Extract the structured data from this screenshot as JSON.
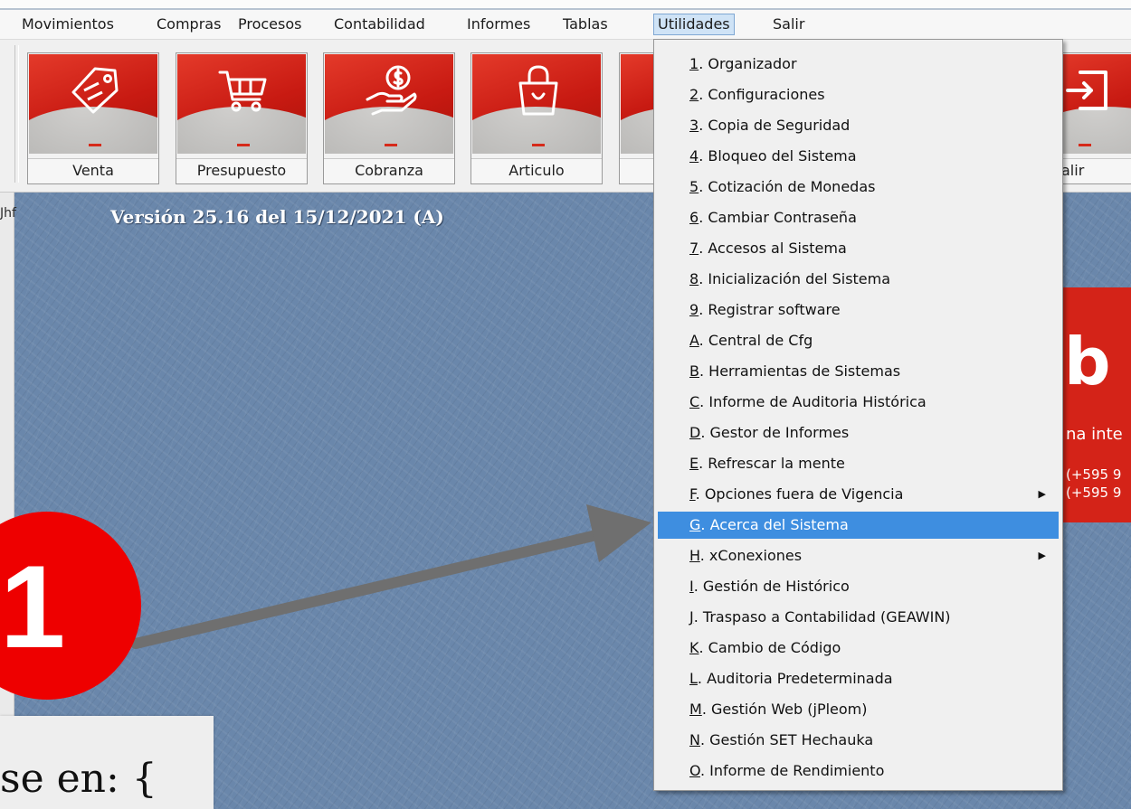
{
  "menubar": {
    "items": [
      "Movimientos",
      "Compras",
      "Procesos",
      "Contabilidad",
      "Informes",
      "Tablas",
      "Utilidades",
      "Salir"
    ],
    "active": "Utilidades"
  },
  "toolbar": {
    "buttons": [
      {
        "label": "Venta",
        "icon": "price-tag-icon"
      },
      {
        "label": "Presupuesto",
        "icon": "shopping-cart-icon"
      },
      {
        "label": "Cobranza",
        "icon": "coin-hand-icon"
      },
      {
        "label": "Articulo",
        "icon": "shopping-bag-icon"
      },
      {
        "label": "alir",
        "icon": "exit-door-icon"
      }
    ]
  },
  "desktop": {
    "user_tag": "Jhf",
    "version": "Versión 25.16 del 15/12/2021  (A)",
    "logo": {
      "mark": "b",
      "tagline": "na inte",
      "phone1": "(+595 9",
      "phone2": "(+595 9"
    }
  },
  "utilidades_menu": {
    "items": [
      {
        "key": "1",
        "text": ". Organizador"
      },
      {
        "key": "2",
        "text": ". Configuraciones"
      },
      {
        "key": "3",
        "text": ". Copia de Seguridad"
      },
      {
        "key": "4",
        "text": ". Bloqueo del Sistema"
      },
      {
        "key": "5",
        "text": ". Cotización de Monedas"
      },
      {
        "key": "6",
        "text": ". Cambiar Contraseña"
      },
      {
        "key": "7",
        "text": ". Accesos al Sistema"
      },
      {
        "key": "8",
        "text": ". Inicialización del Sistema"
      },
      {
        "key": "9",
        "text": ". Registrar software"
      },
      {
        "key": "A",
        "text": ". Central de Cfg"
      },
      {
        "key": "B",
        "text": ". Herramientas de Sistemas"
      },
      {
        "key": "C",
        "text": ". Informe de Auditoria Histórica"
      },
      {
        "key": "D",
        "text": ". Gestor de Informes"
      },
      {
        "key": "E",
        "text": ". Refrescar la mente"
      },
      {
        "key": "F",
        "text": ". Opciones fuera de Vigencia",
        "submenu": true
      },
      {
        "key": "G",
        "text": ". Acerca del Sistema",
        "highlighted": true
      },
      {
        "key": "H",
        "text": ". xConexiones",
        "submenu": true
      },
      {
        "key": "I",
        "text": ". Gestión de Histórico"
      },
      {
        "key": "J",
        "text": ". Traspaso a Contabilidad (GEAWIN)"
      },
      {
        "key": "K",
        "text": ". Cambio de Código"
      },
      {
        "key": "L",
        "text": ". Auditoria Predeterminada"
      },
      {
        "key": "M",
        "text": ". Gestión Web (jPleom)"
      },
      {
        "key": "N",
        "text": ". Gestión SET Hechauka"
      },
      {
        "key": "O",
        "text": ". Informe de Rendimiento"
      }
    ]
  },
  "annotation": {
    "step_number": "1",
    "callout_text": "se en: {"
  },
  "colors": {
    "highlight": "#3e8ee0",
    "badge": "#ee0000",
    "desktop": "#6a87ab",
    "toolbar_red": "#c81a12"
  }
}
